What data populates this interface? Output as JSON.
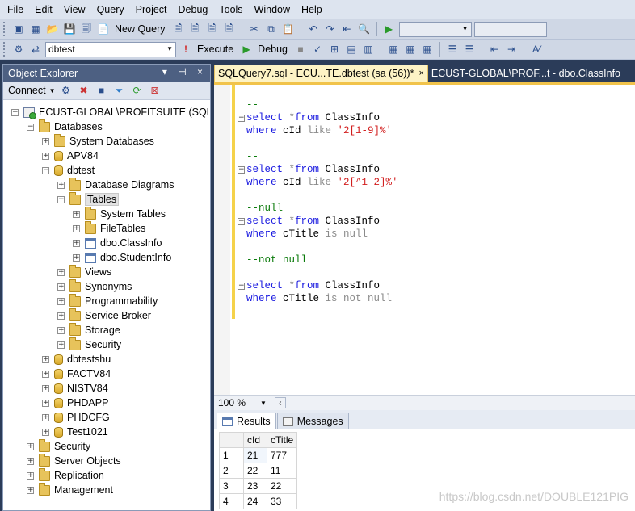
{
  "menu": [
    "File",
    "Edit",
    "View",
    "Query",
    "Project",
    "Debug",
    "Tools",
    "Window",
    "Help"
  ],
  "toolbar1": {
    "new_query": "New Query"
  },
  "toolbar2": {
    "database": "dbtest",
    "execute": "Execute",
    "debug": "Debug"
  },
  "object_explorer": {
    "title": "Object Explorer",
    "pin": "▾ ඞ ×",
    "connect": "Connect",
    "tree": [
      {
        "label": "ECUST-GLOBAL\\PROFITSUITE (SQL Ser",
        "icon": "server",
        "level": 0,
        "exp": "-"
      },
      {
        "label": "Databases",
        "icon": "folder",
        "level": 1,
        "exp": "-"
      },
      {
        "label": "System Databases",
        "icon": "folder",
        "level": 2,
        "exp": "+"
      },
      {
        "label": "APV84",
        "icon": "db",
        "level": 2,
        "exp": "+"
      },
      {
        "label": "dbtest",
        "icon": "db",
        "level": 2,
        "exp": "-"
      },
      {
        "label": "Database Diagrams",
        "icon": "folder",
        "level": 3,
        "exp": "+"
      },
      {
        "label": "Tables",
        "icon": "folder",
        "level": 3,
        "exp": "-",
        "selected": true
      },
      {
        "label": "System Tables",
        "icon": "folder",
        "level": 4,
        "exp": "+"
      },
      {
        "label": "FileTables",
        "icon": "folder",
        "level": 4,
        "exp": "+"
      },
      {
        "label": "dbo.ClassInfo",
        "icon": "table",
        "level": 4,
        "exp": "+"
      },
      {
        "label": "dbo.StudentInfo",
        "icon": "table",
        "level": 4,
        "exp": "+"
      },
      {
        "label": "Views",
        "icon": "folder",
        "level": 3,
        "exp": "+"
      },
      {
        "label": "Synonyms",
        "icon": "folder",
        "level": 3,
        "exp": "+"
      },
      {
        "label": "Programmability",
        "icon": "folder",
        "level": 3,
        "exp": "+"
      },
      {
        "label": "Service Broker",
        "icon": "folder",
        "level": 3,
        "exp": "+"
      },
      {
        "label": "Storage",
        "icon": "folder",
        "level": 3,
        "exp": "+"
      },
      {
        "label": "Security",
        "icon": "folder",
        "level": 3,
        "exp": "+"
      },
      {
        "label": "dbtestshu",
        "icon": "db",
        "level": 2,
        "exp": "+"
      },
      {
        "label": "FACTV84",
        "icon": "db",
        "level": 2,
        "exp": "+"
      },
      {
        "label": "NISTV84",
        "icon": "db",
        "level": 2,
        "exp": "+"
      },
      {
        "label": "PHDAPP",
        "icon": "db",
        "level": 2,
        "exp": "+"
      },
      {
        "label": "PHDCFG",
        "icon": "db",
        "level": 2,
        "exp": "+"
      },
      {
        "label": "Test1021",
        "icon": "db",
        "level": 2,
        "exp": "+"
      },
      {
        "label": "Security",
        "icon": "folder",
        "level": 1,
        "exp": "+"
      },
      {
        "label": "Server Objects",
        "icon": "folder",
        "level": 1,
        "exp": "+"
      },
      {
        "label": "Replication",
        "icon": "folder",
        "level": 1,
        "exp": "+"
      },
      {
        "label": "Management",
        "icon": "folder",
        "level": 1,
        "exp": "+"
      }
    ]
  },
  "tabs": {
    "active": "SQLQuery7.sql - ECU...TE.dbtest (sa (56))*",
    "inactive": "ECUST-GLOBAL\\PROF...t - dbo.ClassInfo"
  },
  "code_lines": [
    {
      "row": 0,
      "fold": false,
      "parts": [
        {
          "c": "cm",
          "t": "--"
        }
      ]
    },
    {
      "row": 1,
      "fold": true,
      "parts": [
        {
          "c": "kw",
          "t": "select "
        },
        {
          "c": "gr",
          "t": "*"
        },
        {
          "c": "kw",
          "t": "from "
        },
        {
          "c": "",
          "t": "ClassInfo"
        }
      ]
    },
    {
      "row": 2,
      "fold": false,
      "parts": [
        {
          "c": "kw",
          "t": "where "
        },
        {
          "c": "",
          "t": "cId "
        },
        {
          "c": "gr",
          "t": "like "
        },
        {
          "c": "st",
          "t": "'2[1-9]%'"
        }
      ]
    },
    {
      "row": 4,
      "fold": false,
      "parts": [
        {
          "c": "cm",
          "t": "--"
        }
      ]
    },
    {
      "row": 5,
      "fold": true,
      "parts": [
        {
          "c": "kw",
          "t": "select "
        },
        {
          "c": "gr",
          "t": "*"
        },
        {
          "c": "kw",
          "t": "from "
        },
        {
          "c": "",
          "t": "ClassInfo"
        }
      ]
    },
    {
      "row": 6,
      "fold": false,
      "parts": [
        {
          "c": "kw",
          "t": "where "
        },
        {
          "c": "",
          "t": "cId "
        },
        {
          "c": "gr",
          "t": "like "
        },
        {
          "c": "st",
          "t": "'2[^1-2]%'"
        }
      ]
    },
    {
      "row": 8,
      "fold": false,
      "parts": [
        {
          "c": "cm",
          "t": "--null"
        }
      ]
    },
    {
      "row": 9,
      "fold": true,
      "parts": [
        {
          "c": "kw",
          "t": "select "
        },
        {
          "c": "gr",
          "t": "*"
        },
        {
          "c": "kw",
          "t": "from "
        },
        {
          "c": "",
          "t": "ClassInfo"
        }
      ]
    },
    {
      "row": 10,
      "fold": false,
      "parts": [
        {
          "c": "kw",
          "t": "where "
        },
        {
          "c": "",
          "t": "cTitle "
        },
        {
          "c": "gr",
          "t": "is null"
        }
      ]
    },
    {
      "row": 12,
      "fold": false,
      "parts": [
        {
          "c": "cm",
          "t": "--not null"
        }
      ]
    },
    {
      "row": 14,
      "fold": true,
      "parts": [
        {
          "c": "kw",
          "t": "select "
        },
        {
          "c": "gr",
          "t": "*"
        },
        {
          "c": "kw",
          "t": "from "
        },
        {
          "c": "",
          "t": "ClassInfo"
        }
      ]
    },
    {
      "row": 15,
      "fold": false,
      "parts": [
        {
          "c": "kw",
          "t": "where "
        },
        {
          "c": "",
          "t": "cTitle "
        },
        {
          "c": "gr",
          "t": "is not null"
        }
      ]
    }
  ],
  "zoom": "100 %",
  "result_tabs": {
    "results": "Results",
    "messages": "Messages"
  },
  "results_grid": {
    "columns": [
      "cId",
      "cTitle"
    ],
    "rows": [
      {
        "n": "1",
        "cId": "21",
        "cTitle": "777"
      },
      {
        "n": "2",
        "cId": "22",
        "cTitle": "11"
      },
      {
        "n": "3",
        "cId": "23",
        "cTitle": "22"
      },
      {
        "n": "4",
        "cId": "24",
        "cTitle": "33"
      }
    ]
  },
  "watermark": "https://blog.csdn.net/DOUBLE121PIG",
  "colors": {
    "title_bar": "#4d6082",
    "active_tab": "#fdf3c5",
    "keyword": "#1c1ce0",
    "comment": "#0a7a0a",
    "string": "#d21e1e"
  }
}
